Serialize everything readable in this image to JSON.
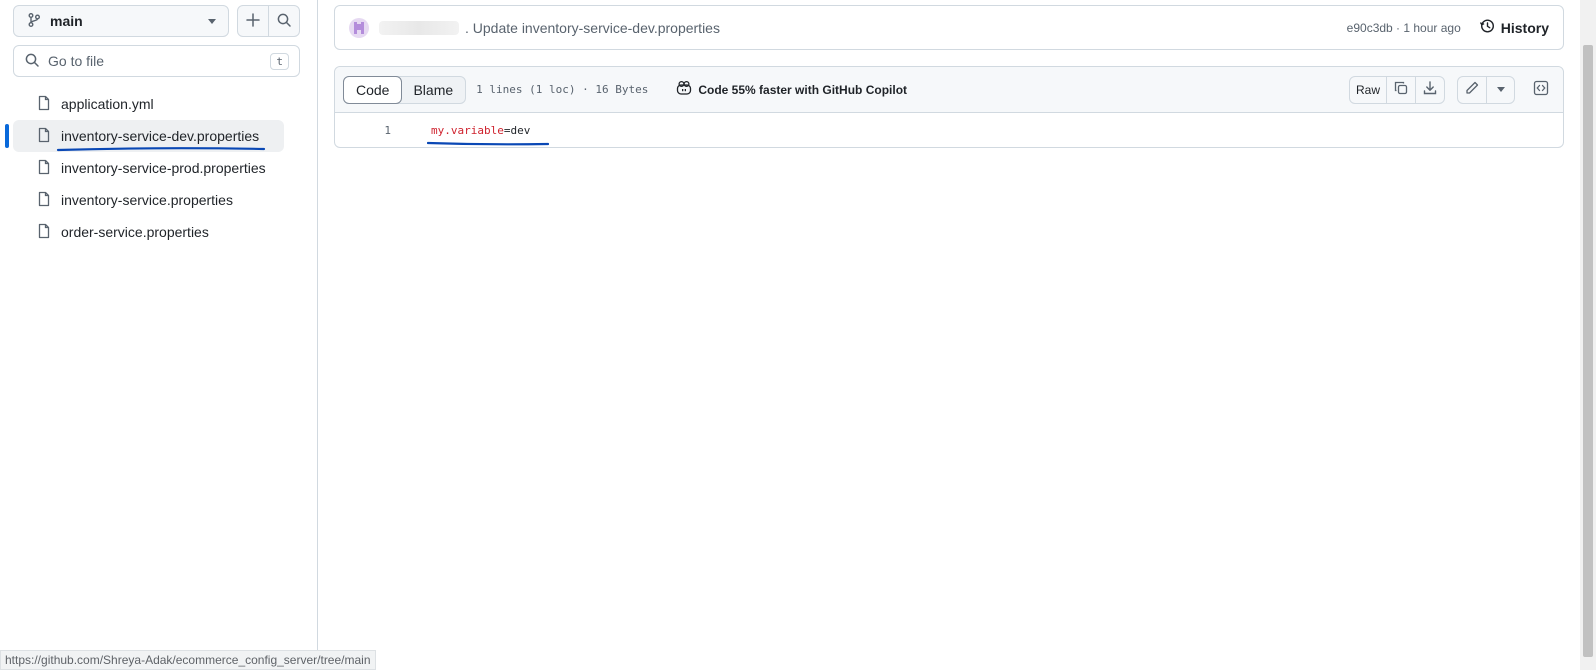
{
  "sidebar": {
    "branch_label": "main",
    "goto_placeholder": "Go to file",
    "goto_shortcut": "t",
    "files": [
      {
        "name": "application.yml"
      },
      {
        "name": "inventory-service-dev.properties"
      },
      {
        "name": "inventory-service-prod.properties"
      },
      {
        "name": "inventory-service.properties"
      },
      {
        "name": "order-service.properties"
      }
    ]
  },
  "commit": {
    "message": ". Update inventory-service-dev.properties",
    "meta": "e90c3db · 1 hour ago",
    "history_label": "History"
  },
  "file": {
    "tabs": {
      "code": "Code",
      "blame": "Blame"
    },
    "info": "1 lines (1 loc) · 16 Bytes",
    "copilot_label": "Code 55% faster with GitHub Copilot",
    "raw_label": "Raw",
    "lines": [
      {
        "number": "1",
        "key": "my.variable",
        "op": "=",
        "value": "dev"
      }
    ]
  },
  "status_url": "https://github.com/Shreya-Adak/ecommerce_config_server/tree/main",
  "colors": {
    "accent": "#0969da",
    "annotation": "#0a48b5",
    "key_token": "#cf222e"
  },
  "icons": [
    "branch-icon",
    "plus-icon",
    "search-icon",
    "file-icon",
    "history-icon",
    "copilot-icon",
    "copy-icon",
    "download-icon",
    "pencil-icon",
    "chevron-down-icon",
    "code-square-icon"
  ]
}
